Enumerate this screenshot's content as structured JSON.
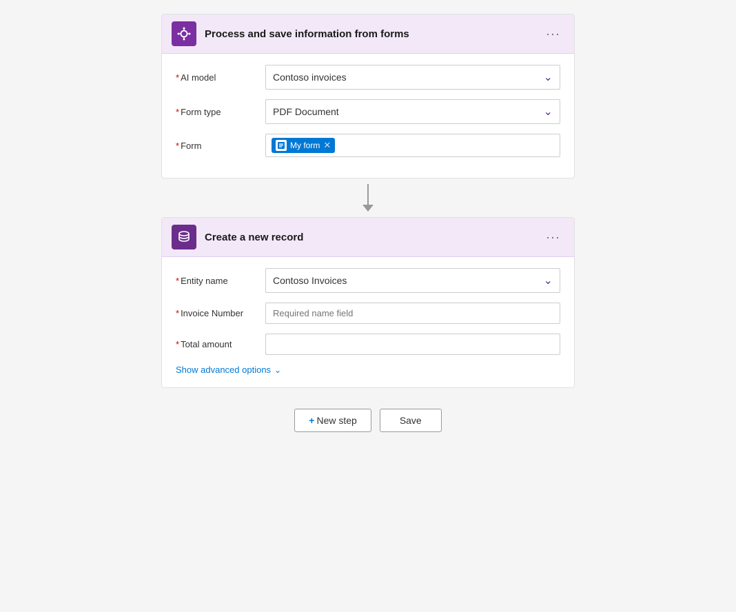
{
  "card1": {
    "title": "Process and save information from forms",
    "icon_label": "ai-builder-icon",
    "fields": {
      "ai_model": {
        "label": "AI model",
        "required": true,
        "value": "Contoso invoices"
      },
      "form_type": {
        "label": "Form type",
        "required": true,
        "value": "PDF Document"
      },
      "form": {
        "label": "Form",
        "required": true,
        "tag_label": "My form"
      }
    },
    "menu_label": "···"
  },
  "connector": {
    "aria": "arrow-connector"
  },
  "card2": {
    "title": "Create a new record",
    "icon_label": "dataverse-icon",
    "fields": {
      "entity_name": {
        "label": "Entity name",
        "required": true,
        "value": "Contoso Invoices"
      },
      "invoice_number": {
        "label": "Invoice Number",
        "required": true,
        "placeholder": "Required name field"
      },
      "total_amount": {
        "label": "Total amount",
        "required": true,
        "placeholder": ""
      }
    },
    "advanced_options_label": "Show advanced options",
    "menu_label": "···"
  },
  "actions": {
    "new_step_label": "+ New step",
    "save_label": "Save"
  }
}
